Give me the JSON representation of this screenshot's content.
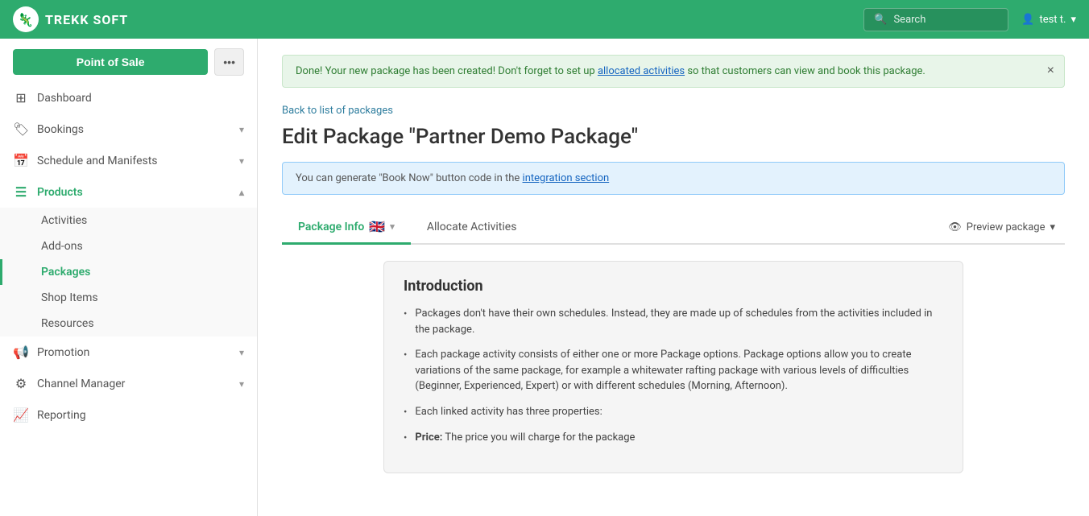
{
  "navbar": {
    "brand": "TREKK SOFT",
    "search_placeholder": "Search",
    "user_label": "test t.",
    "user_icon": "👤"
  },
  "sidebar": {
    "pos_button": "Point of Sale",
    "pos_dots": "•••",
    "items": [
      {
        "id": "dashboard",
        "label": "Dashboard",
        "icon": "⊞",
        "has_chevron": false,
        "active": false
      },
      {
        "id": "bookings",
        "label": "Bookings",
        "icon": "🏷",
        "has_chevron": true,
        "active": false
      },
      {
        "id": "schedule",
        "label": "Schedule and Manifests",
        "icon": "📅",
        "has_chevron": true,
        "active": false
      },
      {
        "id": "products",
        "label": "Products",
        "icon": "☰",
        "has_chevron": true,
        "active": true
      }
    ],
    "products_subitems": [
      {
        "id": "activities",
        "label": "Activities",
        "active": false
      },
      {
        "id": "addons",
        "label": "Add-ons",
        "active": false
      },
      {
        "id": "packages",
        "label": "Packages",
        "active": true
      },
      {
        "id": "shopitems",
        "label": "Shop Items",
        "active": false
      },
      {
        "id": "resources",
        "label": "Resources",
        "active": false
      }
    ],
    "bottom_items": [
      {
        "id": "promotion",
        "label": "Promotion",
        "icon": "📢",
        "has_chevron": true,
        "active": false
      },
      {
        "id": "channel-manager",
        "label": "Channel Manager",
        "icon": "⚙",
        "has_chevron": true,
        "active": false
      },
      {
        "id": "reporting",
        "label": "Reporting",
        "icon": "📈",
        "has_chevron": false,
        "active": false
      }
    ]
  },
  "content": {
    "alert": {
      "text": "Done! Your new package has been created! Don't forget to set up ",
      "link_text": "allocated activities",
      "text2": " so that customers can view and book this package."
    },
    "back_link": "Back to list of packages",
    "page_title": "Edit Package \"Partner Demo Package\"",
    "info_box": {
      "text": "You can generate \"Book Now\" button code in the ",
      "link_text": "integration section"
    },
    "tabs": [
      {
        "id": "package-info",
        "label": "Package Info",
        "active": true,
        "has_flag": true
      },
      {
        "id": "allocate-activities",
        "label": "Allocate Activities",
        "active": false,
        "has_flag": false
      }
    ],
    "preview_btn": "Preview package",
    "intro": {
      "title": "Introduction",
      "items": [
        "Packages don't have their own schedules. Instead, they are made up of schedules from the activities included in the package.",
        "Each package activity consists of either one or more Package options. Package options allow you to create variations of the same package, for example a whitewater rafting package with various levels of difficulties (Beginner, Experienced, Expert) or with different schedules (Morning, Afternoon).",
        "Each linked activity has three properties:",
        "Price: The price you will charge for the package"
      ],
      "item3_prefix": "Each linked activity has three properties:",
      "item4_price_label": "Price:",
      "item4_price_text": " The price you will charge for the package"
    }
  }
}
